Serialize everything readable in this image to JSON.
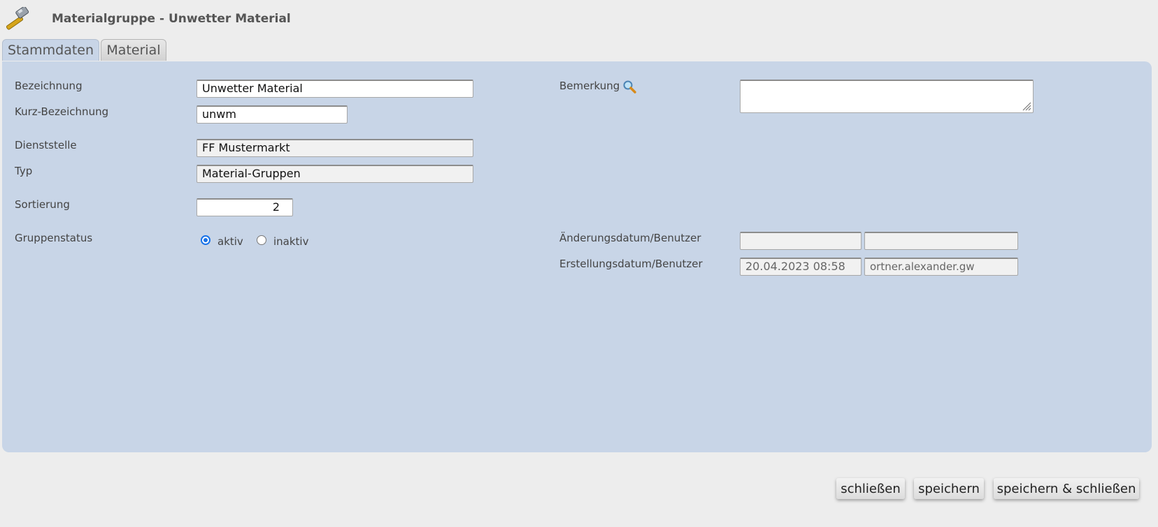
{
  "header": {
    "title": "Materialgruppe - Unwetter Material",
    "icon": "hammer-icon"
  },
  "tabs": [
    {
      "label": "Stammdaten"
    },
    {
      "label": "Material"
    }
  ],
  "form": {
    "bezeichnung": {
      "label": "Bezeichnung",
      "value": "Unwetter Material"
    },
    "kurz": {
      "label": "Kurz-Bezeichnung",
      "value": "unwm"
    },
    "dienststelle": {
      "label": "Dienststelle",
      "value": "FF Mustermarkt"
    },
    "typ": {
      "label": "Typ",
      "value": "Material-Gruppen"
    },
    "sortierung": {
      "label": "Sortierung",
      "value": "2"
    },
    "gruppenstatus": {
      "label": "Gruppenstatus",
      "options": [
        "aktiv",
        "inaktiv"
      ],
      "selected": "aktiv"
    },
    "bemerkung": {
      "label": "Bemerkung",
      "value": "",
      "icon": "magnifier-icon"
    },
    "aenderung": {
      "label": "Änderungsdatum/Benutzer",
      "date": "",
      "user": ""
    },
    "erstellung": {
      "label": "Erstellungsdatum/Benutzer",
      "date": "20.04.2023 08:58",
      "user": "ortner.alexander.gw"
    }
  },
  "buttons": {
    "close": "schließen",
    "save": "speichern",
    "save_close": "speichern & schließen"
  },
  "colors": {
    "panel": "#c8d5e7",
    "background": "#ededed",
    "radio_accent": "#1a73e8"
  }
}
